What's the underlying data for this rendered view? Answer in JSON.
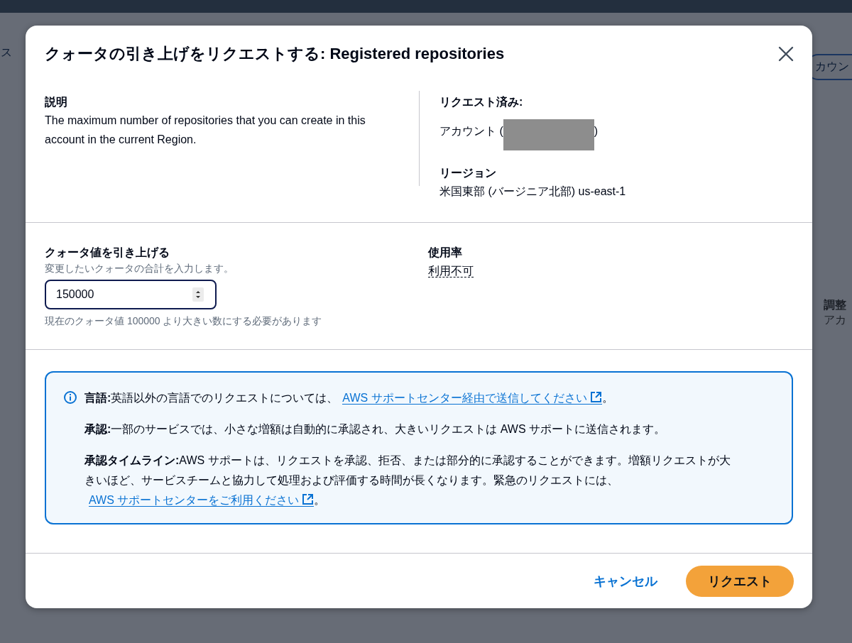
{
  "background": {
    "breadcrumb": "ス",
    "account_button": "カウン",
    "side_heading": "調整",
    "side_text": "アカ"
  },
  "dialog": {
    "title": "クォータの引き上げをリクエストする: Registered repositories",
    "description": {
      "label": "説明",
      "text": "The maximum number of repositories that you can create in this account in the current Region."
    },
    "requested": {
      "label": "リクエスト済み:",
      "account_prefix": "アカウント (",
      "account_redacted": true,
      "account_suffix": ")"
    },
    "region": {
      "label": "リージョン",
      "value": "米国東部 (バージニア北部) us-east-1"
    },
    "quota": {
      "label": "クォータ値を引き上げる",
      "hint": "変更したいクォータの合計を入力します。",
      "value": "150000",
      "constraint": "現在のクォータ値 100000 より大きい数にする必要があります"
    },
    "usage": {
      "label": "使用率",
      "value": "利用不可"
    },
    "info": [
      {
        "label": "言語:",
        "text": "英語以外の言語でのリクエストについては、",
        "link": "AWS サポートセンター経由で送信してください",
        "after": "。"
      },
      {
        "label": "承認:",
        "text": "一部のサービスでは、小さな増額は自動的に承認され、大きいリクエストは AWS サポートに送信されます。"
      },
      {
        "label": "承認タイムライン:",
        "text": "AWS サポートは、リクエストを承認、拒否、または部分的に承認することができます。増額リクエストが大きいほど、サービスチームと協力して処理および評価する時間が長くなります。緊急のリクエストには、",
        "link": "AWS サポートセンターをご利用ください",
        "after": "。"
      }
    ],
    "buttons": {
      "cancel": "キャンセル",
      "submit": "リクエスト"
    }
  }
}
